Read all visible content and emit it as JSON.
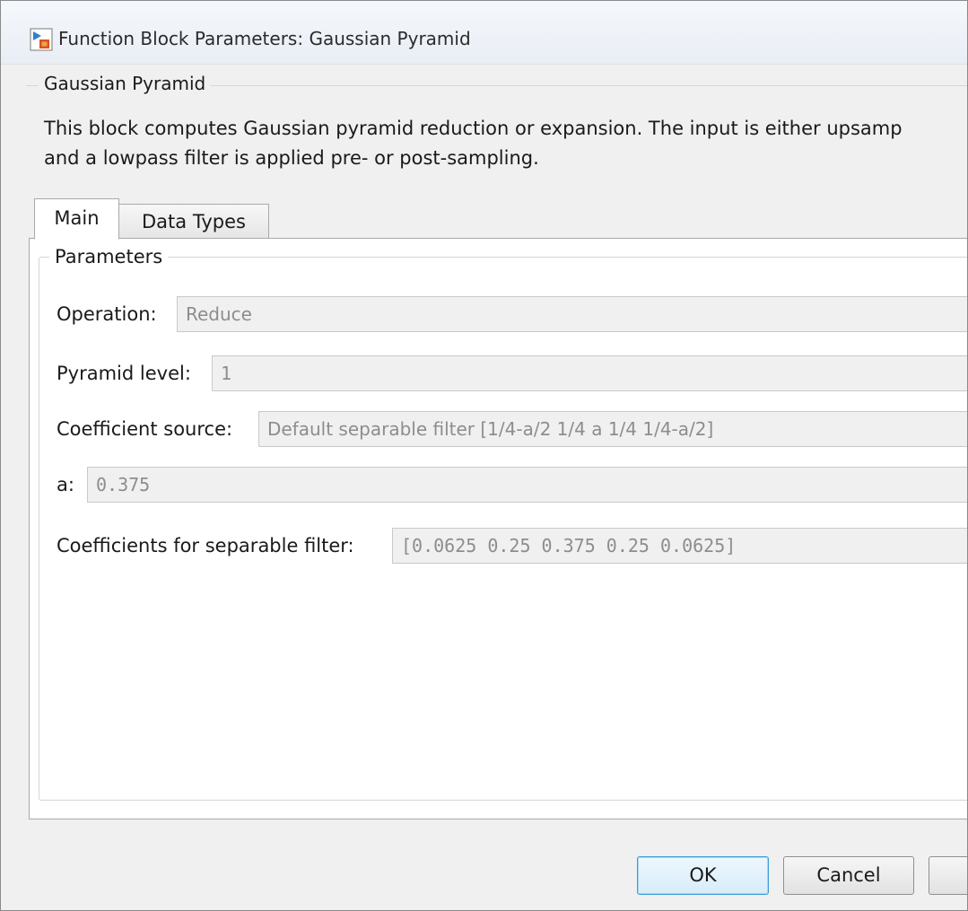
{
  "window": {
    "title": "Function Block Parameters: Gaussian Pyramid",
    "icon": "simulink-block-icon"
  },
  "block": {
    "name": "Gaussian Pyramid",
    "description": "This block computes Gaussian pyramid reduction or expansion.  The input is either upsamp\nand a lowpass filter is applied pre- or post-sampling."
  },
  "tabs": [
    {
      "label": "Main",
      "selected": true
    },
    {
      "label": "Data Types",
      "selected": false
    }
  ],
  "parameters": {
    "group_label": "Parameters",
    "operation": {
      "label": "Operation:",
      "value": "Reduce"
    },
    "pyramid_level": {
      "label": "Pyramid level:",
      "value": "1"
    },
    "coefficient_source": {
      "label": "Coefficient source:",
      "value": "Default separable filter [1/4-a/2  1/4  a  1/4  1/4-a/2]"
    },
    "a": {
      "label": "a:",
      "value": "0.375"
    },
    "coefficients": {
      "label": "Coefficients for separable filter:",
      "value": "[0.0625 0.25 0.375 0.25 0.0625]"
    }
  },
  "buttons": {
    "ok": "OK",
    "cancel": "Cancel",
    "third": ""
  },
  "colors": {
    "dialog_bg": "#f0f0f0",
    "panel_bg": "#ffffff",
    "disabled_text": "#8d8d8d",
    "default_button_border": "#3c9bd6"
  }
}
